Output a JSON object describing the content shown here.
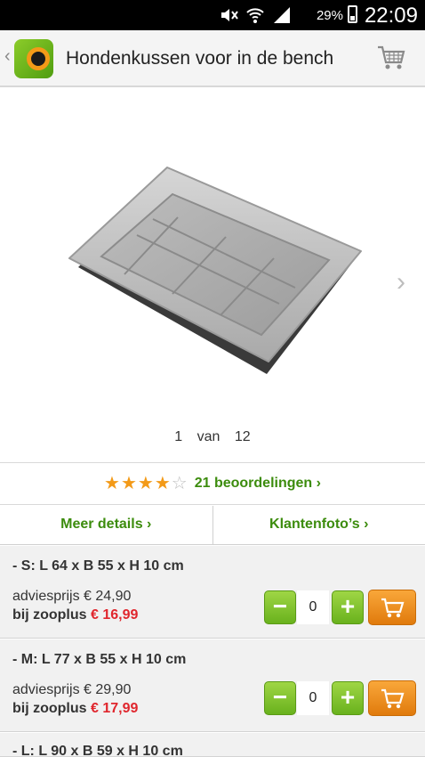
{
  "status_bar": {
    "battery": "29%",
    "time": "22:09"
  },
  "app_bar": {
    "title": "Hondenkussen voor in de bench"
  },
  "gallery": {
    "current": "1",
    "of": "van",
    "total": "12"
  },
  "rating": {
    "value": 4,
    "max": 5,
    "count_label": "21 beoordelingen ›"
  },
  "tabs": [
    {
      "label": "Meer details ›"
    },
    {
      "label": "Klantenfoto’s ›"
    }
  ],
  "variants": [
    {
      "title": "- S: L 64 x B 55 x H 10 cm",
      "advice_label": "adviesprijs € 24,90",
      "price_label": "bij zooplus ",
      "price": "€ 16,99",
      "quantity": "0"
    },
    {
      "title": "- M: L 77 x B 55 x H 10 cm",
      "advice_label": "adviesprijs € 29,90",
      "price_label": "bij zooplus ",
      "price": "€ 17,99",
      "quantity": "0"
    },
    {
      "title": "- L: L 90 x B 59 x H 10 cm"
    }
  ],
  "colors": {
    "green": "#3c8c0d",
    "orange": "#f39a18",
    "red": "#e0262d"
  }
}
